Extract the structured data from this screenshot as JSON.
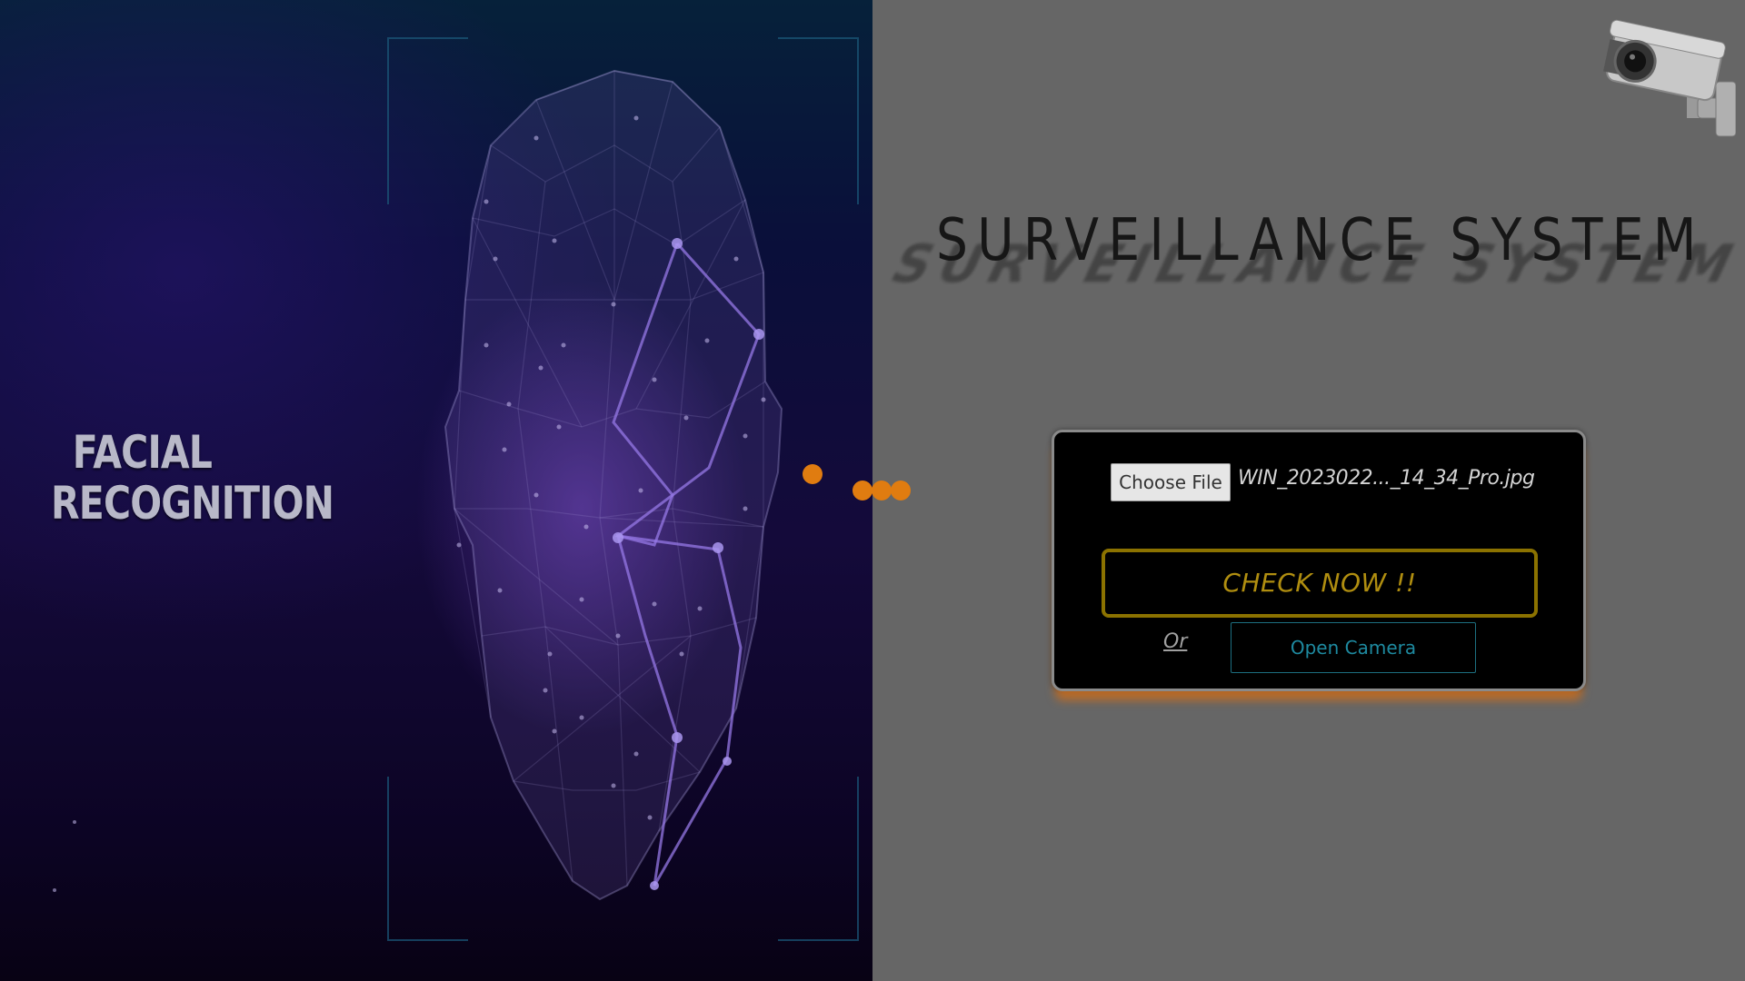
{
  "hero": {
    "title_line1": "FACIAL",
    "title_line2": "RECOGNITION"
  },
  "header": {
    "title": "SURVEILLANCE SYSTEM",
    "camera_icon": "cctv-camera-icon"
  },
  "upload_form": {
    "choose_file_label": "Choose File",
    "selected_file_name": "WIN_2023022..._14_34_Pro.jpg",
    "check_button_label": "CHECK NOW !!",
    "or_label": "Or",
    "open_camera_label": "Open Camera"
  },
  "loader": {
    "icon": "loading-dots-icon"
  },
  "colors": {
    "page_background": "#666666",
    "accent_orange": "#e07c10",
    "check_button_gold": "#b08e10",
    "open_camera_teal": "#1e8aa0"
  }
}
